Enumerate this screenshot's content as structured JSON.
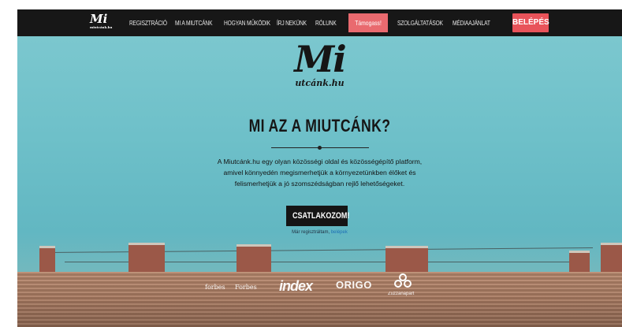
{
  "nav": {
    "logo": "Mi",
    "logo_sub": "miutcánk.hu",
    "items": [
      "Regisztráció",
      "Mi a miutcánk",
      "Hogyan működik",
      "Írj nekünk",
      "Rólunk",
      "Támogass!",
      "Szolgáltatások",
      "Médiaajánlat"
    ],
    "login": "BELÉPÉS"
  },
  "hero": {
    "logo_mi": "Mi",
    "logo_sub": "utcánk.hu",
    "headline": "MI AZ A MIUTCÁNK?",
    "description": [
      "A Miutcánk.hu egy olyan közösségi oldal és közösségépítő platform,",
      "amivel könnyedén megismerhetjük a környezetünkben élőket és",
      "felismerhetjük a jó szomszédságban rejlő lehetőségeket."
    ],
    "cta": "CSATLAKOZOM!",
    "registered_text": "Már regisztráltam,",
    "registered_link": "belépek"
  },
  "press": [
    "forbes",
    "Forbes",
    "index",
    "ORIGO",
    "Zuzzanapart"
  ],
  "colors": {
    "nav_bg": "#171717",
    "pill": "#e96a6f",
    "login": "#e8535a",
    "sky": "#6ec0c9"
  }
}
